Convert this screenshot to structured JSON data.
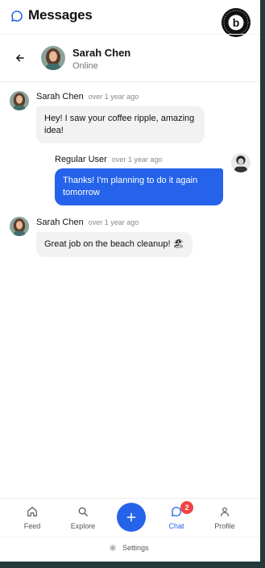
{
  "app": {
    "title": "Messages",
    "brand_logo_letter": "b"
  },
  "chat": {
    "contact_name": "Sarah Chen",
    "contact_status": "Online"
  },
  "messages": [
    {
      "sender": "Sarah Chen",
      "time": "over 1 year ago",
      "text": "Hey! I saw your coffee ripple, amazing idea!",
      "direction": "in"
    },
    {
      "sender": "Regular User",
      "time": "over 1 year ago",
      "text": "Thanks! I'm planning to do it again tomorrow",
      "direction": "out"
    },
    {
      "sender": "Sarah Chen",
      "time": "over 1 year ago",
      "text": "Great job on the beach cleanup! 🏖",
      "direction": "in"
    }
  ],
  "nav": {
    "items": [
      {
        "label": "Feed",
        "icon": "home-icon"
      },
      {
        "label": "Explore",
        "icon": "search-icon"
      },
      {
        "label": "Chat",
        "icon": "chat-icon",
        "badge": "2"
      },
      {
        "label": "Profile",
        "icon": "user-icon"
      }
    ],
    "fab_icon": "plus-icon"
  },
  "footer": {
    "settings_label": "Settings"
  },
  "colors": {
    "accent": "#2563eb",
    "badge": "#ef4444",
    "page_border": "#243a3a"
  }
}
